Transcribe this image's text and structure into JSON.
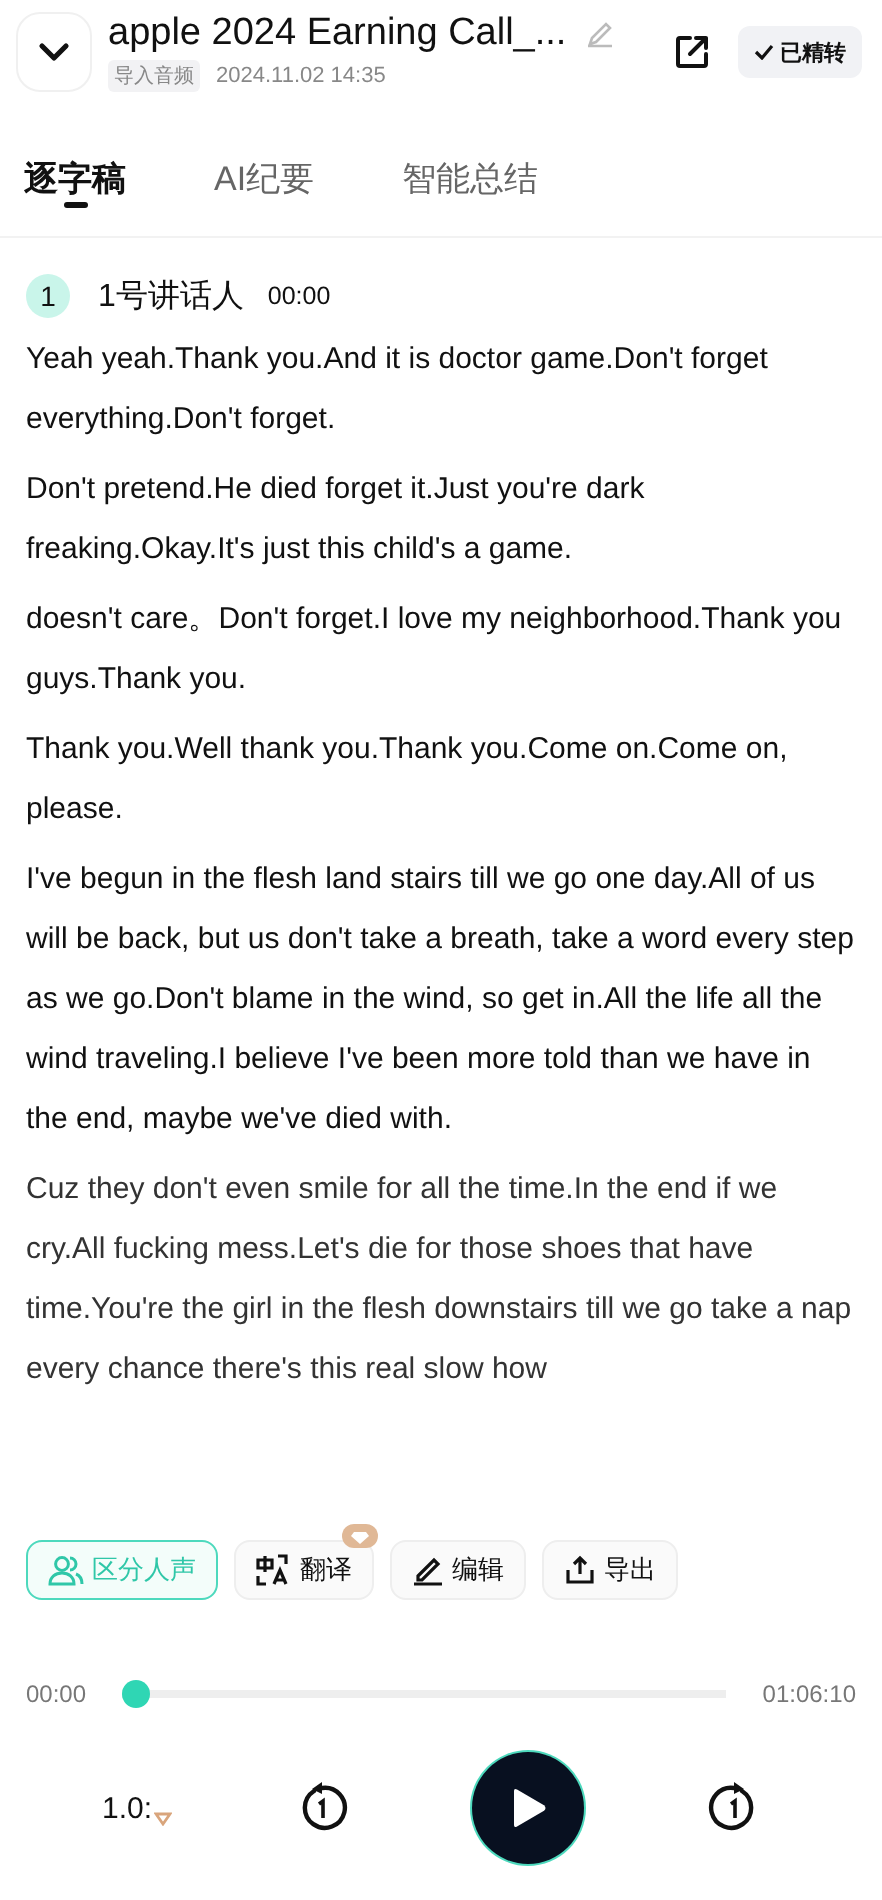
{
  "header": {
    "title": "apple 2024 Earning Call_...",
    "tag": "导入音频",
    "date": "2024.11.02 14:35",
    "status_button": "已精转"
  },
  "tabs": [
    {
      "label": "逐字稿",
      "selected": true
    },
    {
      "label": "AI纪要",
      "selected": false
    },
    {
      "label": "智能总结",
      "selected": false
    }
  ],
  "speaker": {
    "number": "1",
    "name": "1号讲话人",
    "time": "00:00"
  },
  "paragraphs": [
    "Yeah yeah.Thank you.And it is doctor game.Don't forget everything.Don't forget.",
    "Don't pretend.He died forget it.Just you're dark freaking.Okay.It's just this child's a game.",
    "doesn't care。Don't forget.I love my neighborhood.Thank you guys.Thank you.",
    "Thank you.Well thank you.Thank you.Come on.Come on, please.",
    "I've begun in the flesh land stairs till we go one day.All of us will be back, but us don't take a breath, take a word every step as we go.Don't blame in the wind, so get in.All the life all the wind traveling.I believe I've been more told than we have in the end, maybe we've died with.",
    "Cuz they don't even smile for all the time.In the end if we cry.All fucking mess.Let's die for those shoes that have time.You're the girl in the flesh downstairs till we go take a nap every chance there's this real slow how"
  ],
  "actions": [
    {
      "kind": "speakers",
      "label": "区分人声",
      "selected": true,
      "premium": false
    },
    {
      "kind": "translate",
      "label": "翻译",
      "selected": false,
      "premium": true
    },
    {
      "kind": "edit",
      "label": "编辑",
      "selected": false,
      "premium": false
    },
    {
      "kind": "export",
      "label": "导出",
      "selected": false,
      "premium": false
    }
  ],
  "player": {
    "current": "00:00",
    "total": "01:06:10",
    "level": 0,
    "speed": "1.0:"
  }
}
